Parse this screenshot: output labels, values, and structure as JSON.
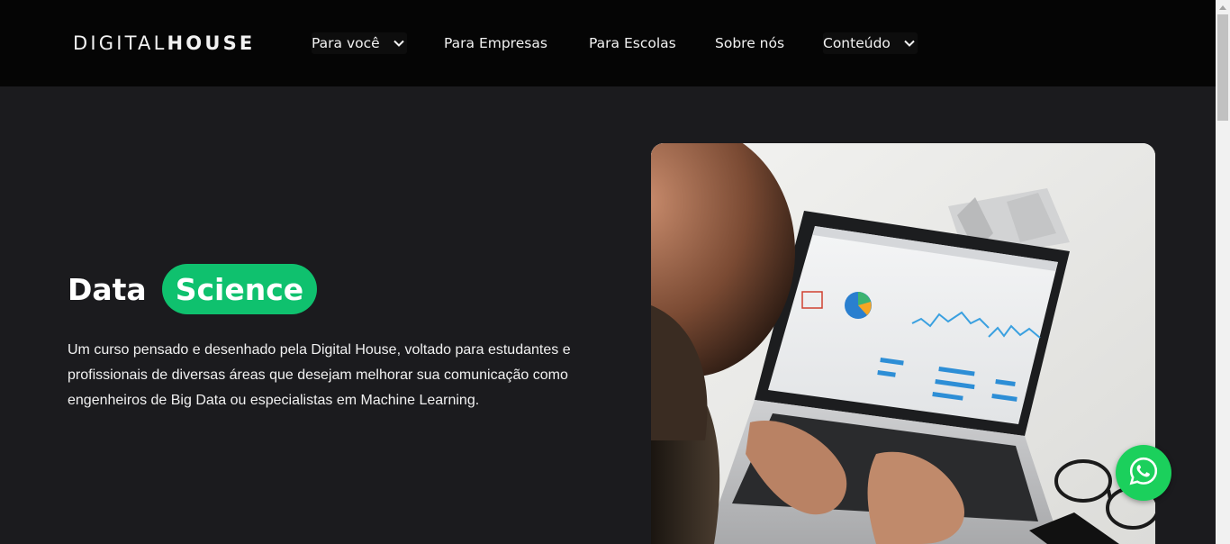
{
  "header": {
    "logo": {
      "part1": "DIGITAL",
      "part2": "HOUSE"
    },
    "nav": [
      {
        "label": "Para você",
        "dropdown": true
      },
      {
        "label": "Para Empresas",
        "dropdown": false
      },
      {
        "label": "Para Escolas",
        "dropdown": false
      },
      {
        "label": "Sobre nós",
        "dropdown": false
      },
      {
        "label": "Conteúdo",
        "dropdown": true
      }
    ]
  },
  "hero": {
    "title_word1": "Data",
    "title_word2": "Science",
    "description": "Um curso pensado e desenhado pela Digital House, voltado para estudantes e profissionais de diversas áreas que desejam melhorar sua comunicação como engenheiros de Big Data ou especialistas em Machine Learning."
  },
  "floating": {
    "icon": "whatsapp-icon"
  },
  "colors": {
    "accent": "#0fc16e",
    "whatsapp": "#1bd05c",
    "header_bg": "#050505",
    "page_bg": "#1b1b1e"
  }
}
